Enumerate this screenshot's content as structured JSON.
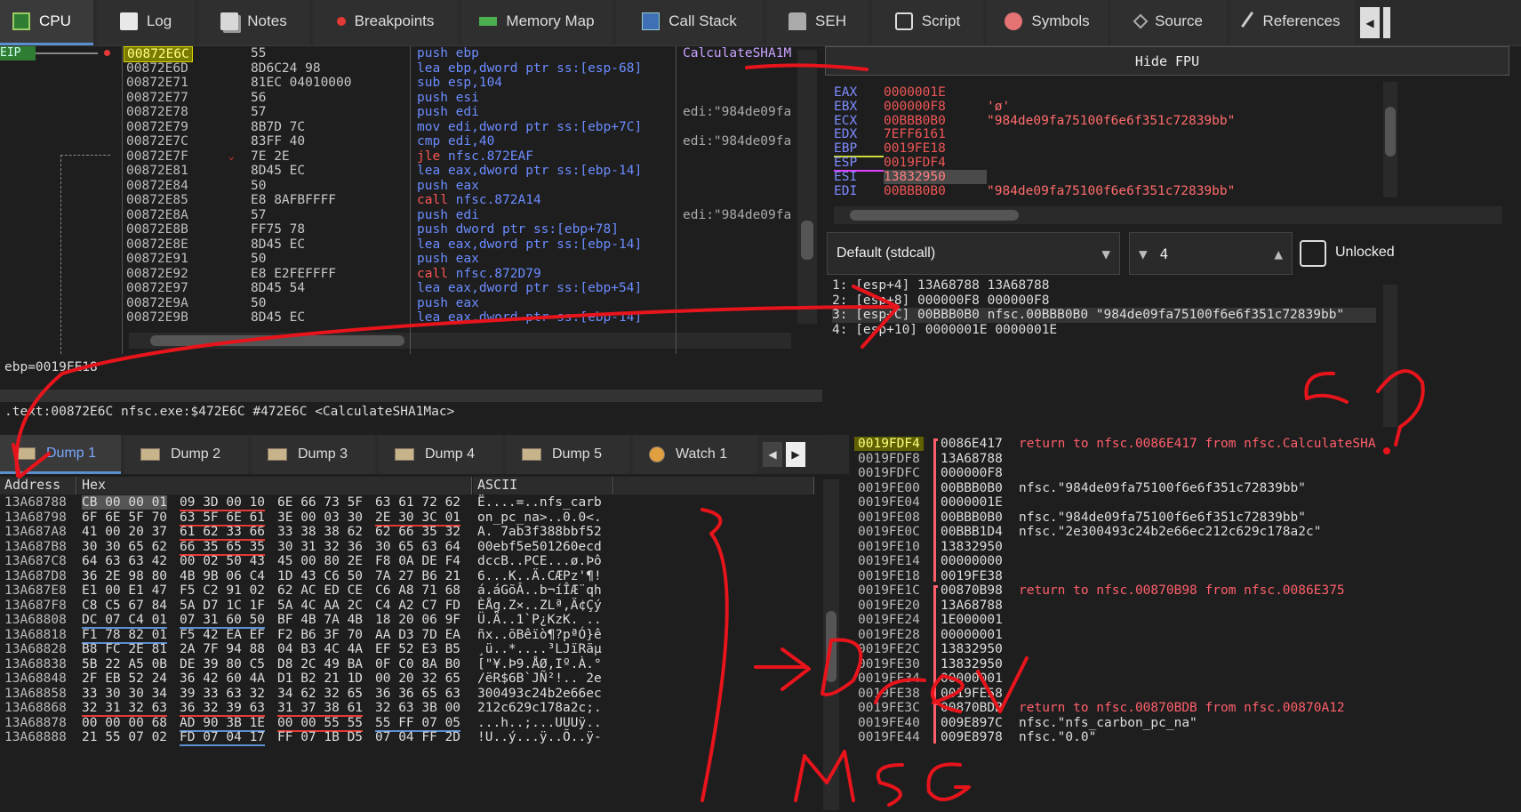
{
  "tabs": [
    {
      "label": "CPU",
      "icon": "cpu-icon"
    },
    {
      "label": "Log",
      "icon": "log-icon"
    },
    {
      "label": "Notes",
      "icon": "notes-icon"
    },
    {
      "label": "Breakpoints",
      "icon": "breakpoint-icon"
    },
    {
      "label": "Memory Map",
      "icon": "memory-map-icon"
    },
    {
      "label": "Call Stack",
      "icon": "call-stack-icon"
    },
    {
      "label": "SEH",
      "icon": "seh-icon"
    },
    {
      "label": "Script",
      "icon": "script-icon"
    },
    {
      "label": "Symbols",
      "icon": "symbols-icon"
    },
    {
      "label": "Source",
      "icon": "source-icon"
    },
    {
      "label": "References",
      "icon": "references-icon"
    }
  ],
  "disasm": {
    "eip_label": "EIP",
    "lines": [
      {
        "addr": "00872E6C",
        "bytes": "55",
        "op": "push",
        "args": " ebp",
        "cmt": "CalculateSHA1M"
      },
      {
        "addr": "00872E6D",
        "bytes": "8D6C24 98",
        "op": "lea",
        "args": " ebp,dword ptr ss:[esp-68]",
        "cmt": ""
      },
      {
        "addr": "00872E71",
        "bytes": "81EC 04010000",
        "op": "sub",
        "args": " esp,104",
        "cmt": ""
      },
      {
        "addr": "00872E77",
        "bytes": "56",
        "op": "push",
        "args": " esi",
        "cmt": ""
      },
      {
        "addr": "00872E78",
        "bytes": "57",
        "op": "push",
        "args": " edi",
        "cmt": "edi:\"984de09fa"
      },
      {
        "addr": "00872E79",
        "bytes": "8B7D 7C",
        "op": "mov",
        "args": " edi,dword ptr ss:[ebp+7C]",
        "cmt": ""
      },
      {
        "addr": "00872E7C",
        "bytes": "83FF 40",
        "op": "cmp",
        "args": " edi,40",
        "cmt": "edi:\"984de09fa"
      },
      {
        "addr": "00872E7F",
        "bytes": "7E 2E",
        "op": "jle",
        "args": " nfsc.872EAF",
        "cmt": ""
      },
      {
        "addr": "00872E81",
        "bytes": "8D45 EC",
        "op": "lea",
        "args": " eax,dword ptr ss:[ebp-14]",
        "cmt": ""
      },
      {
        "addr": "00872E84",
        "bytes": "50",
        "op": "push",
        "args": " eax",
        "cmt": ""
      },
      {
        "addr": "00872E85",
        "bytes": "E8 8AFBFFFF",
        "op": "call",
        "args": " nfsc.872A14",
        "cmt": ""
      },
      {
        "addr": "00872E8A",
        "bytes": "57",
        "op": "push",
        "args": " edi",
        "cmt": "edi:\"984de09fa"
      },
      {
        "addr": "00872E8B",
        "bytes": "FF75 78",
        "op": "push",
        "args": " dword ptr ss:[ebp+78]",
        "cmt": ""
      },
      {
        "addr": "00872E8E",
        "bytes": "8D45 EC",
        "op": "lea",
        "args": " eax,dword ptr ss:[ebp-14]",
        "cmt": ""
      },
      {
        "addr": "00872E91",
        "bytes": "50",
        "op": "push",
        "args": " eax",
        "cmt": ""
      },
      {
        "addr": "00872E92",
        "bytes": "E8 E2FEFFFF",
        "op": "call",
        "args": " nfsc.872D79",
        "cmt": ""
      },
      {
        "addr": "00872E97",
        "bytes": "8D45 54",
        "op": "lea",
        "args": " eax,dword ptr ss:[ebp+54]",
        "cmt": ""
      },
      {
        "addr": "00872E9A",
        "bytes": "50",
        "op": "push",
        "args": " eax",
        "cmt": ""
      },
      {
        "addr": "00872E9B",
        "bytes": "8D45 EC",
        "op": "lea",
        "args": " eax,dword ptr ss:[ebp-14]",
        "cmt": ""
      }
    ],
    "info_line": "ebp=0019FE18",
    "location_line": ".text:00872E6C nfsc.exe:$472E6C #472E6C <CalculateSHA1Mac>"
  },
  "registers": {
    "hide_fpu_label": "Hide FPU",
    "rows": [
      {
        "name": "EAX",
        "value": "0000001E",
        "str": ""
      },
      {
        "name": "EBX",
        "value": "000000F8",
        "str": "'ø'"
      },
      {
        "name": "ECX",
        "value": "00BBB0B0",
        "str": "\"984de09fa75100f6e6f351c72839bb\""
      },
      {
        "name": "EDX",
        "value": "7EFF6161",
        "str": ""
      },
      {
        "name": "EBP",
        "value": "0019FE18",
        "str": ""
      },
      {
        "name": "ESP",
        "value": "0019FDF4",
        "str": ""
      },
      {
        "name": "ESI",
        "value": "13832950",
        "str": ""
      },
      {
        "name": "EDI",
        "value": "00BBB0B0",
        "str": "\"984de09fa75100f6e6f351c72839bb\""
      }
    ]
  },
  "callconv": {
    "convention": "Default (stdcall)",
    "arg_count": "4",
    "unlocked_label": "Unlocked",
    "args": [
      "1: [esp+4] 13A68788 13A68788",
      "2: [esp+8] 000000F8 000000F8",
      "3: [esp+C] 00BBB0B0 nfsc.00BBB0B0 \"984de09fa75100f6e6f351c72839bb\"",
      "4: [esp+10] 0000001E 0000001E"
    ]
  },
  "dump_tabs": [
    {
      "label": "Dump 1"
    },
    {
      "label": "Dump 2"
    },
    {
      "label": "Dump 3"
    },
    {
      "label": "Dump 4"
    },
    {
      "label": "Dump 5"
    },
    {
      "label": "Watch 1"
    }
  ],
  "dump": {
    "headers": {
      "address": "Address",
      "hex": "Hex",
      "ascii": "ASCII"
    },
    "rows": [
      {
        "addr": "13A68788",
        "hex": [
          "CB 00 00 01",
          "09 3D 00 10",
          "6E 66 73 5F",
          "63 61 72 62"
        ],
        "ascii": "Ë....=..nfs_carb"
      },
      {
        "addr": "13A68798",
        "hex": [
          "6F 6E 5F 70",
          "63 5F 6E 61",
          "3E 00 03 30",
          "2E 30 3C 01"
        ],
        "ascii": "on_pc_na>..0.0<."
      },
      {
        "addr": "13A687A8",
        "hex": [
          "41 00 20 37",
          "61 62 33 66",
          "33 38 38 62",
          "62 66 35 32"
        ],
        "ascii": "A. 7ab3f388bbf52"
      },
      {
        "addr": "13A687B8",
        "hex": [
          "30 30 65 62",
          "66 35 65 35",
          "30 31 32 36",
          "30 65 63 64"
        ],
        "ascii": "00ebf5e501260ecd"
      },
      {
        "addr": "13A687C8",
        "hex": [
          "64 63 63 42",
          "00 02 50 43",
          "45 00 80 2E",
          "F8 0A DE F4"
        ],
        "ascii": "dccB..PCE...ø.Þô"
      },
      {
        "addr": "13A687D8",
        "hex": [
          "36 2E 98 80",
          "4B 9B 06 C4",
          "1D 43 C6 50",
          "7A 27 B6 21"
        ],
        "ascii": "6...K..Ä.CÆPz'¶!"
      },
      {
        "addr": "13A687E8",
        "hex": [
          "E1 00 E1 47",
          "F5 C2 91 02",
          "62 AC ED CE",
          "C6 A8 71 68"
        ],
        "ascii": "á.áGõÂ..b¬íÎÆ¨qh"
      },
      {
        "addr": "13A687F8",
        "hex": [
          "C8 C5 67 84",
          "5A D7 1C 1F",
          "5A 4C AA 2C",
          "C4 A2 C7 FD"
        ],
        "ascii": "ÈÅg.Z×..ZLª,Ä¢Çý"
      },
      {
        "addr": "13A68808",
        "hex": [
          "DC 07 C4 01",
          "07 31 60 50",
          "BF 4B 7A 4B",
          "18 20 06 9F"
        ],
        "ascii": "Ü.Ä..1`P¿KzK. .."
      },
      {
        "addr": "13A68818",
        "hex": [
          "F1 78 82 01",
          "F5 42 EA EF",
          "F2 B6 3F 70",
          "AA D3 7D EA"
        ],
        "ascii": "ñx..õBêïò¶?pªÓ}ê"
      },
      {
        "addr": "13A68828",
        "hex": [
          "B8 FC 2E 81",
          "2A 7F 94 88",
          "04 B3 4C 4A",
          "EF 52 E3 B5"
        ],
        "ascii": "¸ü..*....³LJïRãµ"
      },
      {
        "addr": "13A68838",
        "hex": [
          "5B 22 A5 0B",
          "DE 39 80 C5",
          "D8 2C 49 BA",
          "0F C0 8A B0"
        ],
        "ascii": "[\"¥.Þ9.ÅØ,Iº.À.°"
      },
      {
        "addr": "13A68848",
        "hex": [
          "2F EB 52 24",
          "36 42 60 4A",
          "D1 B2 21 1D",
          "00 20 32 65"
        ],
        "ascii": "/ëR$6B`JÑ²!.. 2e"
      },
      {
        "addr": "13A68858",
        "hex": [
          "33 30 30 34",
          "39 33 63 32",
          "34 62 32 65",
          "36 36 65 63"
        ],
        "ascii": "300493c24b2e66ec"
      },
      {
        "addr": "13A68868",
        "hex": [
          "32 31 32 63",
          "36 32 39 63",
          "31 37 38 61",
          "32 63 3B 00"
        ],
        "ascii": "212c629c178a2c;."
      },
      {
        "addr": "13A68878",
        "hex": [
          "00 00 00 68",
          "AD 90 3B 1E",
          "00 00 55 55",
          "55 FF 07 05"
        ],
        "ascii": "...h..;...UUUÿ.."
      },
      {
        "addr": "13A68888",
        "hex": [
          "21 55 07 02",
          "FD 07 04 17",
          "FF 07 1B D5",
          "07 04 FF 2D"
        ],
        "ascii": "!U..ý...ÿ..Õ..ÿ-"
      }
    ]
  },
  "stack": {
    "rows": [
      {
        "addr": "0019FDF4",
        "val": "0086E417",
        "cmt": "return to nfsc.0086E417 from nfsc.CalculateSHA",
        "ret": true
      },
      {
        "addr": "0019FDF8",
        "val": "13A68788",
        "cmt": "",
        "ret": false
      },
      {
        "addr": "0019FDFC",
        "val": "000000F8",
        "cmt": "",
        "ret": false
      },
      {
        "addr": "0019FE00",
        "val": "00BBB0B0",
        "cmt": "nfsc.\"984de09fa75100f6e6f351c72839bb\"",
        "ret": false
      },
      {
        "addr": "0019FE04",
        "val": "0000001E",
        "cmt": "",
        "ret": false
      },
      {
        "addr": "0019FE08",
        "val": "00BBB0B0",
        "cmt": "nfsc.\"984de09fa75100f6e6f351c72839bb\"",
        "ret": false
      },
      {
        "addr": "0019FE0C",
        "val": "00BBB1D4",
        "cmt": "nfsc.\"2e300493c24b2e66ec212c629c178a2c\"",
        "ret": false
      },
      {
        "addr": "0019FE10",
        "val": "13832950",
        "cmt": "",
        "ret": false
      },
      {
        "addr": "0019FE14",
        "val": "00000000",
        "cmt": "",
        "ret": false
      },
      {
        "addr": "0019FE18",
        "val": "0019FE38",
        "cmt": "",
        "ret": false
      },
      {
        "addr": "0019FE1C",
        "val": "00870B98",
        "cmt": "return to nfsc.00870B98 from nfsc.0086E375",
        "ret": true
      },
      {
        "addr": "0019FE20",
        "val": "13A68788",
        "cmt": "",
        "ret": false
      },
      {
        "addr": "0019FE24",
        "val": "1E000001",
        "cmt": "",
        "ret": false
      },
      {
        "addr": "0019FE28",
        "val": "00000001",
        "cmt": "",
        "ret": false
      },
      {
        "addr": "0019FE2C",
        "val": "13832950",
        "cmt": "",
        "ret": false
      },
      {
        "addr": "0019FE30",
        "val": "13832950",
        "cmt": "",
        "ret": false
      },
      {
        "addr": "0019FE34",
        "val": "00000001",
        "cmt": "",
        "ret": false
      },
      {
        "addr": "0019FE38",
        "val": "0019FE58",
        "cmt": "",
        "ret": false
      },
      {
        "addr": "0019FE3C",
        "val": "00870BDB",
        "cmt": "return to nfsc.00870BDB from nfsc.00870A12",
        "ret": true
      },
      {
        "addr": "0019FE40",
        "val": "009E897C",
        "cmt": "nfsc.\"nfs_carbon_pc_na\"",
        "ret": false
      },
      {
        "addr": "0019FE44",
        "val": "009E8978",
        "cmt": "nfsc.\"0.0\"",
        "ret": false
      }
    ]
  },
  "colors": {
    "annotation": "#e8141c",
    "accent": "#5a8fd0",
    "return": "#ff5f6b"
  }
}
